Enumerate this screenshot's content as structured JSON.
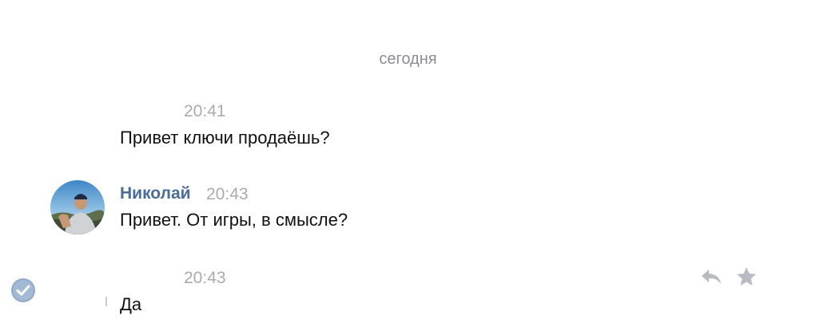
{
  "date_separator": "сегодня",
  "messages": [
    {
      "time": "20:41",
      "text": "Привет ключи продаёшь?"
    },
    {
      "author": "Николай",
      "time": "20:43",
      "text": "Привет. От игры, в смысле?"
    },
    {
      "time": "20:43",
      "text": "Да"
    }
  ],
  "icons": {
    "avatar": "user-photo",
    "read_status": "check-circle-icon",
    "reply": "reply-icon",
    "favorite": "star-icon"
  },
  "colors": {
    "author_name": "#4a6c95",
    "timestamp": "#a8abaf",
    "message_text": "#111111",
    "icon_gray": "#b8bcc2",
    "check_blue": "#8fa9c9"
  }
}
